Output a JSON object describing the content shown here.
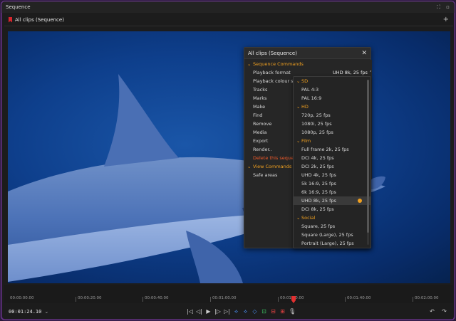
{
  "window": {
    "title": "Sequence"
  },
  "tab": {
    "label": "All clips (Sequence)"
  },
  "timeline": {
    "labels": [
      "00:00:00.00",
      "00:00:20.00",
      "00:00:40.00",
      "00:01:00.00",
      "00:01:20.00",
      "00:01:40.00",
      "00:02:00.00"
    ]
  },
  "transport": {
    "timecode": "00:01:24.10"
  },
  "popup": {
    "title": "All clips (Sequence)",
    "sequence_commands": "Sequence Commands",
    "items": [
      "Playback format",
      "Playback colour space",
      "Tracks",
      "Marks",
      "Make",
      "Find",
      "Remove",
      "Media",
      "Export",
      "Render..",
      "Delete this sequence"
    ],
    "playback_format_value": "UHD 8k, 25 fps",
    "view_commands": "View Commands",
    "view_items": [
      "Safe areas"
    ]
  },
  "formats": {
    "groups": [
      {
        "name": "SD",
        "items": [
          "PAL 4:3",
          "PAL 16:9"
        ]
      },
      {
        "name": "HD",
        "items": [
          "720p, 25 fps",
          "1080i, 25 fps",
          "1080p, 25 fps"
        ]
      },
      {
        "name": "Film",
        "items": [
          "Full frame 2k, 25 fps",
          "DCI 4k, 25 fps",
          "DCI 2k, 25 fps",
          "UHD 4k, 25 fps",
          "5k 16:9, 25 fps",
          "6k 16:9, 25 fps",
          "UHD 8k, 25 fps",
          "DCI 8k, 25 fps"
        ]
      },
      {
        "name": "Social",
        "items": [
          "Square, 25 fps",
          "Square (Large), 25 fps",
          "Portrait (Large), 25 fps"
        ]
      }
    ],
    "selected": "UHD 8k, 25 fps"
  },
  "colors": {
    "accent": "#f0a020",
    "danger": "#f05a2a",
    "playhead": "#e23030",
    "frame": "#7a3fa0"
  }
}
